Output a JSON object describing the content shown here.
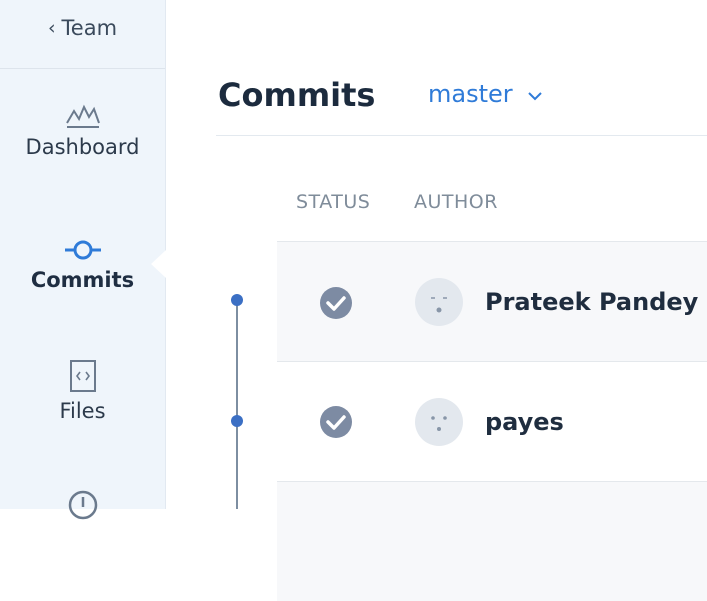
{
  "sidebar": {
    "back_label": "Team",
    "items": [
      {
        "label": "Dashboard",
        "icon": "dashboard-icon"
      },
      {
        "label": "Commits",
        "icon": "commits-icon",
        "active": true
      },
      {
        "label": "Files",
        "icon": "files-icon"
      },
      {
        "label": "",
        "icon": "issues-icon"
      }
    ]
  },
  "header": {
    "title": "Commits",
    "branch": "master"
  },
  "table": {
    "columns": [
      "STATUS",
      "AUTHOR"
    ],
    "rows": [
      {
        "status": "success",
        "author": "Prateek Pandey"
      },
      {
        "status": "success",
        "author": "payes"
      },
      {
        "status": "",
        "author": ""
      }
    ]
  },
  "colors": {
    "accent": "#2f7bd8",
    "sidebar_bg": "#eff5fb",
    "status_icon": "#7d8ba3",
    "timeline_dot": "#3b6fc4"
  }
}
